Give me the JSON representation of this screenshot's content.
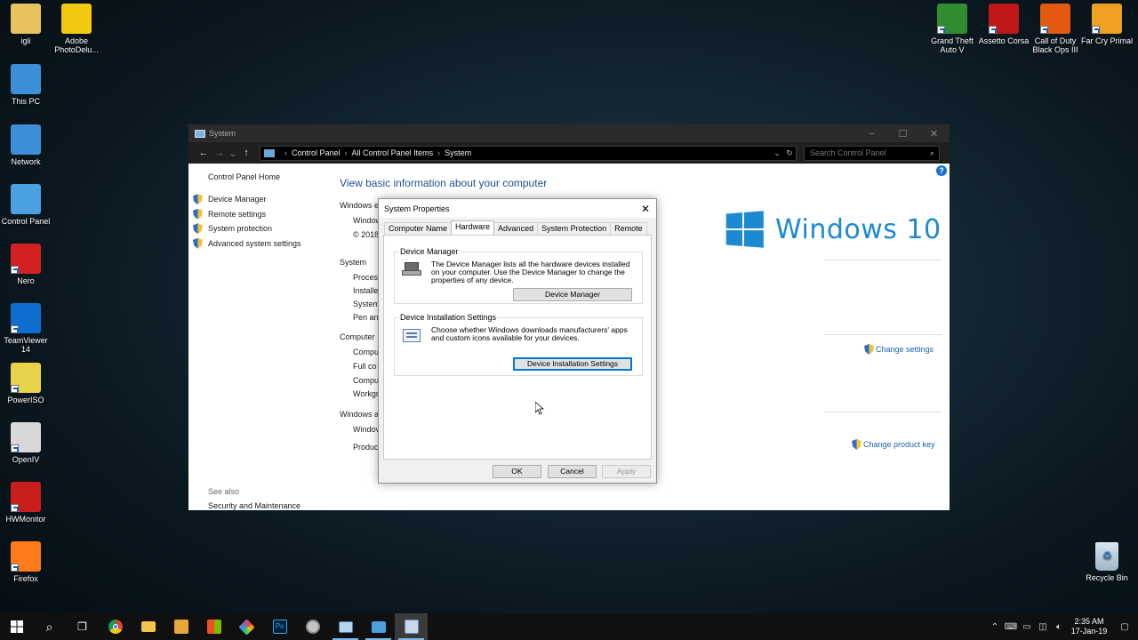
{
  "desktop": {
    "left_icons": [
      {
        "label": "igli",
        "icon": "user-folder-icon",
        "color": "#e8c25a"
      },
      {
        "label": "Adobe PhotoDelu...",
        "icon": "photodeluxe-icon",
        "color": "#f2c811"
      },
      {
        "label": "This PC",
        "icon": "this-pc-icon",
        "color": "#3d8fd8"
      },
      {
        "label": "Network",
        "icon": "network-icon",
        "color": "#3d8fd8"
      },
      {
        "label": "Control Panel",
        "icon": "control-panel-icon",
        "color": "#4aa0e0"
      },
      {
        "label": "Nero",
        "icon": "nero-icon",
        "color": "#d32020"
      },
      {
        "label": "TeamViewer 14",
        "icon": "teamviewer-icon",
        "color": "#0e6fd1"
      },
      {
        "label": "PowerISO",
        "icon": "poweriso-icon",
        "color": "#e8d24a"
      },
      {
        "label": "OpenIV",
        "icon": "openiv-icon",
        "color": "#d8d8d8"
      },
      {
        "label": "HWMonitor",
        "icon": "hwmonitor-icon",
        "color": "#c81e1e"
      },
      {
        "label": "Firefox",
        "icon": "firefox-icon",
        "color": "#ff7a1a"
      }
    ],
    "right_icons": [
      {
        "label": "Grand Theft Auto V",
        "icon": "gta-v-icon",
        "color": "#2f8c2f"
      },
      {
        "label": "Assetto Corsa",
        "icon": "assetto-corsa-icon",
        "color": "#c01818"
      },
      {
        "label": "Call of Duty Black Ops III",
        "icon": "black-ops-icon",
        "color": "#e35a10"
      },
      {
        "label": "Far Cry Primal",
        "icon": "far-cry-primal-icon",
        "color": "#f0a020"
      }
    ],
    "recycle_bin": {
      "label": "Recycle Bin",
      "icon": "recycle-bin-icon"
    }
  },
  "window": {
    "title": "System",
    "breadcrumbs": [
      "Control Panel",
      "All Control Panel Items",
      "System"
    ],
    "search_placeholder": "Search Control Panel",
    "left_pane": {
      "home": "Control Panel Home",
      "links": [
        "Device Manager",
        "Remote settings",
        "System protection",
        "Advanced system settings"
      ],
      "see_also": "See also",
      "see_also_link": "Security and Maintenance"
    },
    "main": {
      "title": "View basic information about your computer",
      "truncated_lines": [
        "Windows e",
        "Window",
        "© 2018",
        "System",
        "Process",
        "Installe",
        "System",
        "Pen and",
        "Computer",
        "Compu",
        "Full co",
        "Compu",
        "Workgr",
        "Windows a",
        "Windov",
        "Produc"
      ],
      "windows_brand": "Windows 10",
      "change_settings": "Change settings",
      "change_product_key": "Change product key"
    }
  },
  "dialog": {
    "title": "System Properties",
    "tabs": [
      "Computer Name",
      "Hardware",
      "Advanced",
      "System Protection",
      "Remote"
    ],
    "active_tab": "Hardware",
    "device_manager": {
      "group_label": "Device Manager",
      "description": "The Device Manager lists all the hardware devices installed on your computer. Use the Device Manager to change the properties of any device.",
      "button": "Device Manager"
    },
    "device_install": {
      "group_label": "Device Installation Settings",
      "description": "Choose whether Windows downloads manufacturers' apps and custom icons available for your devices.",
      "button": "Device Installation Settings"
    },
    "ok": "OK",
    "cancel": "Cancel",
    "apply": "Apply"
  },
  "taskbar": {
    "apps": [
      "start",
      "search",
      "task-view",
      "chrome",
      "file-explorer",
      "media-player",
      "store",
      "paint",
      "photoshop",
      "globe",
      "remote-desktop",
      "control-panel",
      "system-properties"
    ],
    "clock_time": "2:35 AM",
    "clock_date": "17-Jan-19"
  }
}
